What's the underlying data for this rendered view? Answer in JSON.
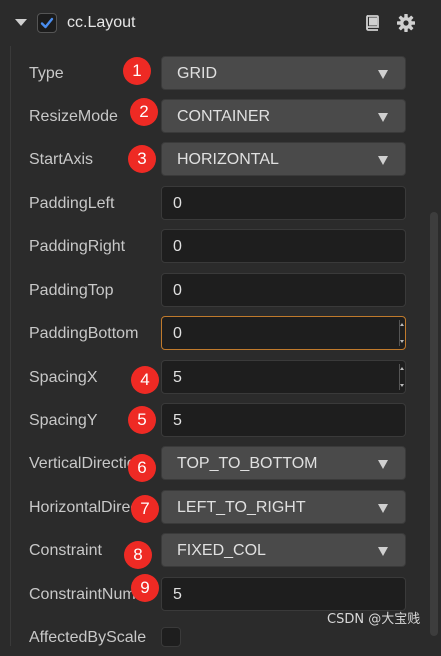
{
  "component": {
    "title": "cc.Layout",
    "enabled": true,
    "collapse_icon": "triangle-down-icon",
    "enable_icon": "checkbox-checked-icon",
    "help_icon": "book-icon",
    "settings_icon": "gear-icon"
  },
  "properties": [
    {
      "label": "Type",
      "kind": "dropdown",
      "value": "GRID",
      "badge": "1"
    },
    {
      "label": "ResizeMode",
      "kind": "dropdown",
      "value": "CONTAINER",
      "badge": "2"
    },
    {
      "label": "StartAxis",
      "kind": "dropdown",
      "value": "HORIZONTAL",
      "badge": "3"
    },
    {
      "label": "PaddingLeft",
      "kind": "number",
      "value": "0"
    },
    {
      "label": "PaddingRight",
      "kind": "number",
      "value": "0"
    },
    {
      "label": "PaddingTop",
      "kind": "number",
      "value": "0"
    },
    {
      "label": "PaddingBottom",
      "kind": "number",
      "value": "0"
    },
    {
      "label": "SpacingX",
      "kind": "number",
      "value": "5",
      "badge": "4"
    },
    {
      "label": "SpacingY",
      "kind": "number",
      "value": "5",
      "badge": "5"
    },
    {
      "label": "VerticalDirection",
      "kind": "dropdown",
      "value": "TOP_TO_BOTTOM",
      "badge": "6"
    },
    {
      "label": "HorizontalDirection",
      "kind": "dropdown",
      "value": "LEFT_TO_RIGHT",
      "badge": "7"
    },
    {
      "label": "Constraint",
      "kind": "dropdown",
      "value": "FIXED_COL",
      "badge": "8"
    },
    {
      "label": "ConstraintNum",
      "kind": "number",
      "value": "5",
      "badge": "9"
    },
    {
      "label": "AffectedByScale",
      "kind": "checkbox",
      "value": ""
    }
  ],
  "colors": {
    "badge": "#ee2a24",
    "focus_border": "#c07a2c",
    "checkbox_accent": "#4a8ef0"
  },
  "watermark": "CSDN @大宝贱"
}
